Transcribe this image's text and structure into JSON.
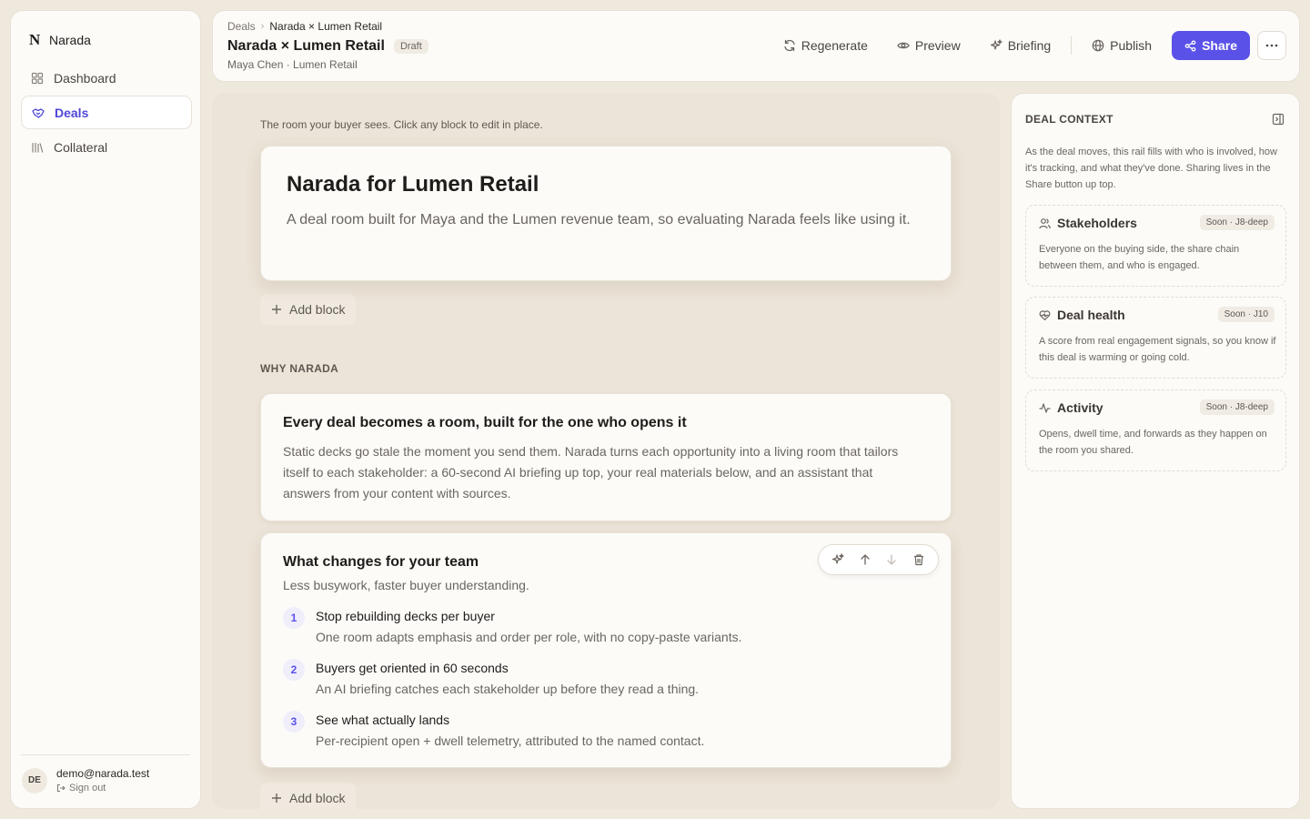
{
  "app": {
    "logo_letter": "N",
    "name": "Narada"
  },
  "sidebar": {
    "items": [
      {
        "label": "Dashboard",
        "icon": "grid-icon"
      },
      {
        "label": "Deals",
        "icon": "handshake-icon",
        "active": true
      },
      {
        "label": "Collateral",
        "icon": "library-icon"
      }
    ],
    "user": {
      "initials": "DE",
      "email": "demo@narada.test",
      "signout": "Sign out"
    }
  },
  "header": {
    "breadcrumb": {
      "root": "Deals",
      "current": "Narada × Lumen Retail"
    },
    "title": "Narada × Lumen Retail",
    "status": "Draft",
    "subtitle": "Maya Chen · Lumen Retail",
    "actions": {
      "regenerate": "Regenerate",
      "preview": "Preview",
      "briefing": "Briefing",
      "publish": "Publish",
      "share": "Share"
    }
  },
  "canvas": {
    "hint": "The room your buyer sees. Click any block to edit in place.",
    "hero": {
      "title": "Narada for Lumen Retail",
      "text": "A deal room built for Maya and the Lumen revenue team, so evaluating Narada feels like using it."
    },
    "add_block": "Add block",
    "section_label": "WHY NARADA",
    "why_card": {
      "title": "Every deal becomes a room, built for the one who opens it",
      "text": "Static decks go stale the moment you send them. Narada turns each opportunity into a living room that tailors itself to each stakeholder: a 60-second AI briefing up top, your real materials below, and an assistant that answers from your content with sources."
    },
    "changes_card": {
      "title": "What changes for your team",
      "subtitle": "Less busywork, faster buyer understanding.",
      "steps": [
        {
          "num": "1",
          "title": "Stop rebuilding decks per buyer",
          "desc": "One room adapts emphasis and order per role, with no copy-paste variants."
        },
        {
          "num": "2",
          "title": "Buyers get oriented in 60 seconds",
          "desc": "An AI briefing catches each stakeholder up before they read a thing."
        },
        {
          "num": "3",
          "title": "See what actually lands",
          "desc": "Per-recipient open + dwell telemetry, attributed to the named contact."
        }
      ]
    }
  },
  "rail": {
    "title": "DEAL CONTEXT",
    "intro": "As the deal moves, this rail fills with who is involved, how it's tracking, and what they've done. Sharing lives in the Share button up top.",
    "cards": [
      {
        "name": "Stakeholders",
        "icon": "users-icon",
        "badge": "Soon · J8-deep",
        "desc": "Everyone on the buying side, the share chain between them, and who is engaged."
      },
      {
        "name": "Deal health",
        "icon": "heart-pulse-icon",
        "badge": "Soon · J10",
        "desc": "A score from real engagement signals, so you know if this deal is warming or going cold."
      },
      {
        "name": "Activity",
        "icon": "activity-icon",
        "badge": "Soon · J8-deep",
        "desc": "Opens, dwell time, and forwards as they happen on the room you shared."
      }
    ]
  },
  "colors": {
    "accent": "#5a52e8",
    "background": "#efe8dd",
    "surface": "#fcfbf8"
  }
}
